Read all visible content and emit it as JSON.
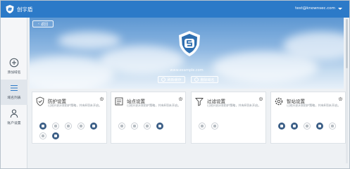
{
  "app": {
    "name": "创宇盾",
    "user_email": "test@knownsec.com"
  },
  "sidebar": {
    "items": [
      {
        "label": "添加域名",
        "icon": "plus-circle-icon"
      },
      {
        "label": "域名列表",
        "icon": "list-icon",
        "active": true
      },
      {
        "label": "账户设置",
        "icon": "user-icon"
      }
    ]
  },
  "hero": {
    "back_label": "返回",
    "domain": "www.example.com",
    "buttons": {
      "refresh_label": "刷新缓存",
      "delete_label": "删除域名"
    }
  },
  "cards": [
    {
      "title": "防护设置",
      "desc": "已经开启3项防护策略，共有8项未开启。",
      "icon": "shield-icon",
      "toggles": [
        true,
        false,
        false,
        false,
        true,
        false,
        true
      ]
    },
    {
      "title": "站点设置",
      "desc": "已经开启3项防护策略，共有8项未开启。",
      "icon": "site-icon",
      "toggles": [
        false,
        false,
        false,
        true
      ]
    },
    {
      "title": "过滤设置",
      "desc": "已经开启3项防护策略，共有8项未开启。",
      "icon": "filter-icon",
      "toggles": [
        false,
        false
      ]
    },
    {
      "title": "智站设置",
      "desc": "已经开启3项防护策略，共有8项未开启。",
      "icon": "gear-icon",
      "toggles": [
        true,
        true,
        false,
        true,
        false
      ]
    }
  ],
  "colors": {
    "topbar": "#2c7ac8",
    "toggle_on": "#3b5e86",
    "accent": "#2c7ac8"
  }
}
